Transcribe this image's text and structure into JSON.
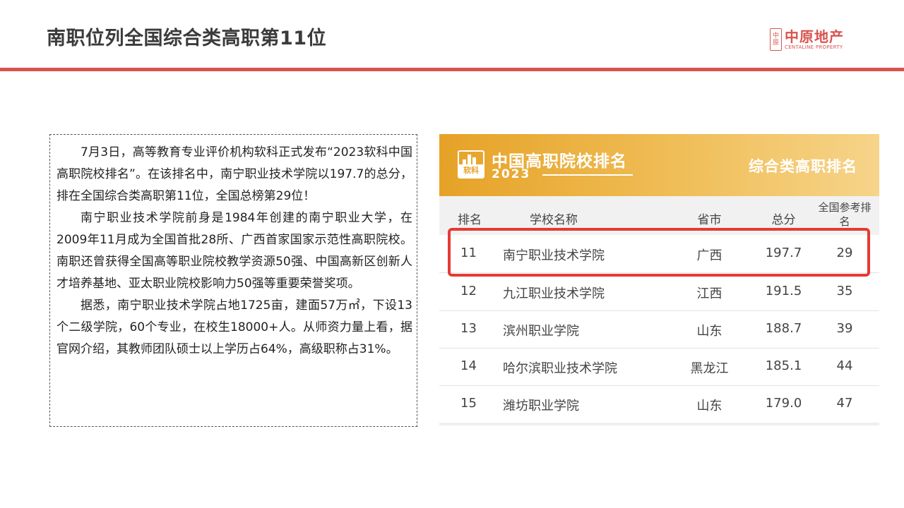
{
  "header": {
    "title": "南职位列全国综合类高职第11位",
    "logo_cn": "中原地产",
    "logo_en": "CENTALINE PROPERTY",
    "logo_seal": [
      "中",
      "原"
    ],
    "accent_color": "#d9534f"
  },
  "article": {
    "paragraphs": [
      "7月3日，高等教育专业评价机构软科正式发布“2023软科中国高职院校排名”。在该排名中，南宁职业技术学院以197.7的总分，排在全国综合类高职第11位，全国总榜第29位！",
      "南宁职业技术学院前身是1984年创建的南宁职业大学，在2009年11月成为全国首批28所、广西首家国家示范性高职院校。南职还曾获得全国高等职业院校教学资源50强、中国高新区创新人才培养基地、亚太职业院校影响力50强等重要荣誉奖项。",
      "据悉，南宁职业技术学院占地1725亩，建面57万㎡，下设13个二级学院，60个专业，在校生18000+人。从师资力量上看，据官网介绍，其教师团队硕士以上学历占64%，高级职称占31%。"
    ]
  },
  "ranking": {
    "brand": "软科",
    "title": "中国高职院校排名",
    "year": "2023",
    "category": "综合类高职排名",
    "header_color": "#e6a227",
    "highlight_color": "#e53a33",
    "columns": {
      "rank": "排名",
      "name": "学校名称",
      "province": "省市",
      "score": "总分",
      "national_ref": "全国参考排名"
    },
    "rows": [
      {
        "rank": "11",
        "name": "南宁职业技术学院",
        "province": "广西",
        "score": "197.7",
        "national_ref": "29"
      },
      {
        "rank": "12",
        "name": "九江职业技术学院",
        "province": "江西",
        "score": "191.5",
        "national_ref": "35"
      },
      {
        "rank": "13",
        "name": "滨州职业学院",
        "province": "山东",
        "score": "188.7",
        "national_ref": "39"
      },
      {
        "rank": "14",
        "name": "哈尔滨职业技术学院",
        "province": "黑龙江",
        "score": "185.1",
        "national_ref": "44"
      },
      {
        "rank": "15",
        "name": "潍坊职业学院",
        "province": "山东",
        "score": "179.0",
        "national_ref": "47"
      }
    ]
  }
}
